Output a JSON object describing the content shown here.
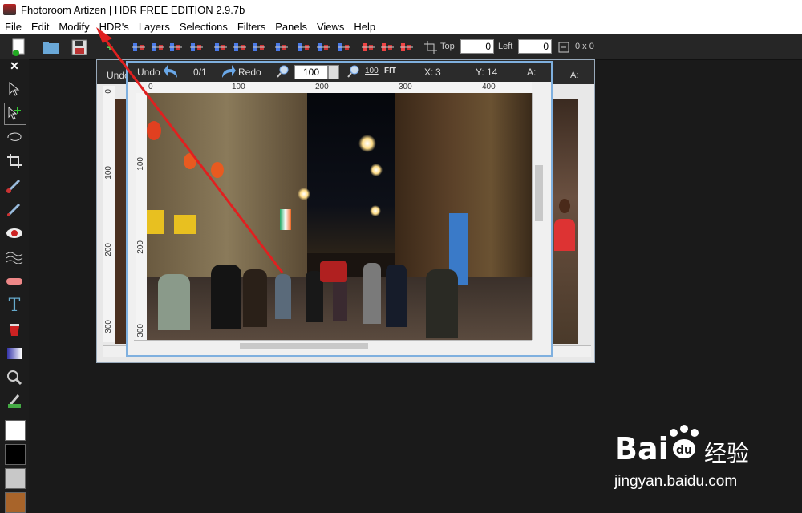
{
  "window": {
    "title": "Fhotoroom Artizen | HDR FREE EDITION 2.9.7b"
  },
  "menu": [
    "File",
    "Edit",
    "Modify",
    "HDR's",
    "Layers",
    "Selections",
    "Filters",
    "Panels",
    "Views",
    "Help"
  ],
  "toolbar": {
    "top_label": "Top",
    "top_value": "0",
    "left_label": "Left",
    "left_value": "0",
    "size_readout": "0 x 0"
  },
  "doc_toolbar": {
    "undo_label": "Undo",
    "history": "0/1",
    "redo_label": "Redo",
    "zoom_value": "100",
    "zoom_100_label": "100",
    "zoom_fit_label": "FIT",
    "x_label": "X:",
    "x_value": "3",
    "y_label": "Y:",
    "y_value": "14",
    "a_label": "A:",
    "back_undo_label": "Undo",
    "back_a_label": "A:"
  },
  "rulers": {
    "h_ticks": [
      "0",
      "100",
      "200",
      "300",
      "400"
    ],
    "v_ticks": [
      "100",
      "200",
      "300"
    ],
    "back_v_ticks": [
      "0",
      "100",
      "200",
      "300"
    ]
  },
  "watermark": {
    "brand": "Bai",
    "brand_cn": "经验",
    "url": "jingyan.baidu.com"
  },
  "colors": {
    "annotation_arrow": "#e02020",
    "window_border": "#7fb0df",
    "primary_color": "#ffffff",
    "secondary_color": "#000000"
  }
}
